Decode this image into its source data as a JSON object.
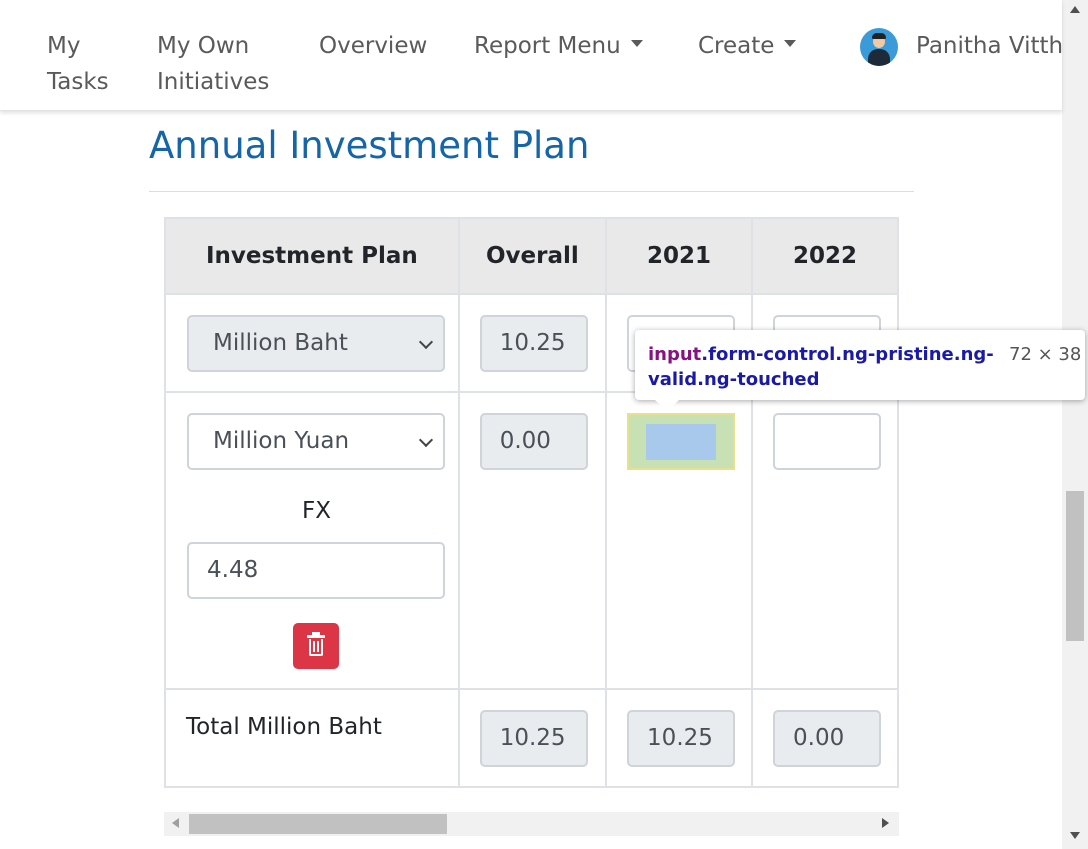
{
  "nav": {
    "items": [
      {
        "label_line1": "My",
        "label_line2": "Tasks"
      },
      {
        "label_line1": "My Own",
        "label_line2": "Initiatives"
      },
      {
        "label": "Overview"
      },
      {
        "label": "Report Menu"
      },
      {
        "label": "Create"
      }
    ],
    "user_name": "Panitha Vitth"
  },
  "page": {
    "title": "Annual Investment Plan"
  },
  "table": {
    "headers": [
      "Investment Plan",
      "Overall",
      "2021",
      "2022"
    ],
    "rows": [
      {
        "currency": "Million Baht",
        "overall": "10.25",
        "y2021": "",
        "y2022": ""
      },
      {
        "currency": "Million Yuan",
        "overall": "0.00",
        "y2021": "",
        "y2022": "",
        "fx_label": "FX",
        "fx_value": "4.48"
      }
    ],
    "total": {
      "label": "Total Million Baht",
      "overall": "10.25",
      "y2021": "10.25",
      "y2022": "0.00"
    }
  },
  "devtools_tooltip": {
    "tag": "input",
    "classes": ".form-control.ng-pristine.ng-valid.ng-touched",
    "dimensions": "72 × 38"
  }
}
